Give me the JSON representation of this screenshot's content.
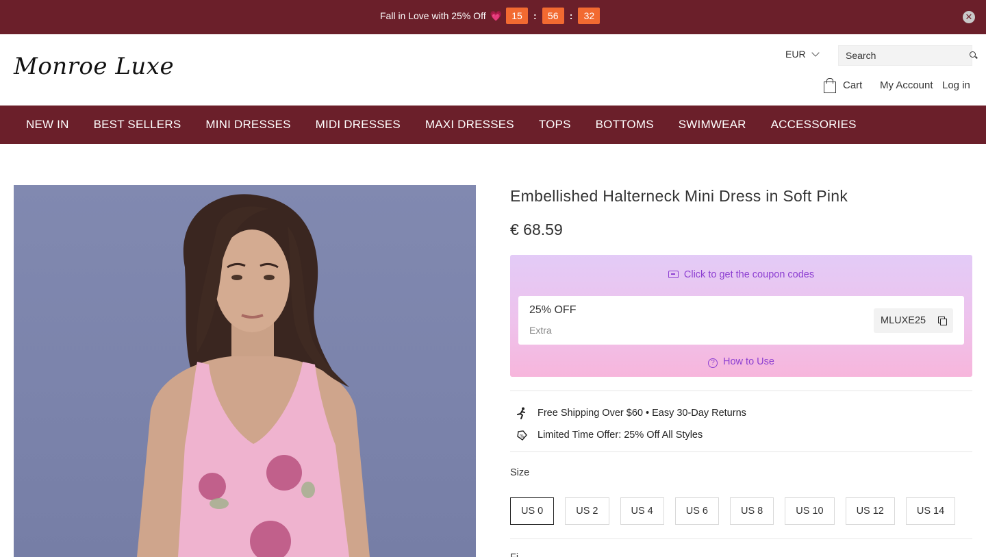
{
  "announcement": {
    "text": "Fall in Love with 25% Off",
    "heart": "💗",
    "timer": {
      "hours": "15",
      "minutes": "56",
      "seconds": "32",
      "separator": ":"
    },
    "close_glyph": "✕"
  },
  "header": {
    "logo": "Monroe Luxe",
    "currency": "EUR",
    "search_placeholder": "Search",
    "cart_label": "Cart",
    "account_label": "My Account",
    "login_label": "Log in"
  },
  "nav": {
    "items": [
      "NEW IN",
      "BEST SELLERS",
      "MINI DRESSES",
      "MIDI DRESSES",
      "MAXI DRESSES",
      "TOPS",
      "BOTTOMS",
      "SWIMWEAR",
      "ACCESSORIES"
    ]
  },
  "product": {
    "title": "Embellished Halterneck Mini Dress in Soft Pink",
    "price": "€ 68.59"
  },
  "coupon": {
    "header": "Click to get the coupon codes",
    "discount": "25% OFF",
    "sub": "Extra",
    "code": "MLUXE25",
    "howto": "How to Use",
    "howto_glyph": "?"
  },
  "perks": [
    {
      "icon": "running-person-icon",
      "text": "Free Shipping Over $60 • Easy 30-Day Returns"
    },
    {
      "icon": "discount-tag-icon",
      "text": "Limited Time Offer: 25% Off All Styles"
    }
  ],
  "size": {
    "label": "Size",
    "options": [
      "US 0",
      "US 2",
      "US 4",
      "US 6",
      "US 8",
      "US 10",
      "US 12",
      "US 14"
    ],
    "selected": "US 0"
  },
  "next_section_label": "Fi",
  "colors": {
    "brand": "#6b1f2a",
    "timer": "#f26a31",
    "coupon_accent": "#8d3fd1"
  }
}
